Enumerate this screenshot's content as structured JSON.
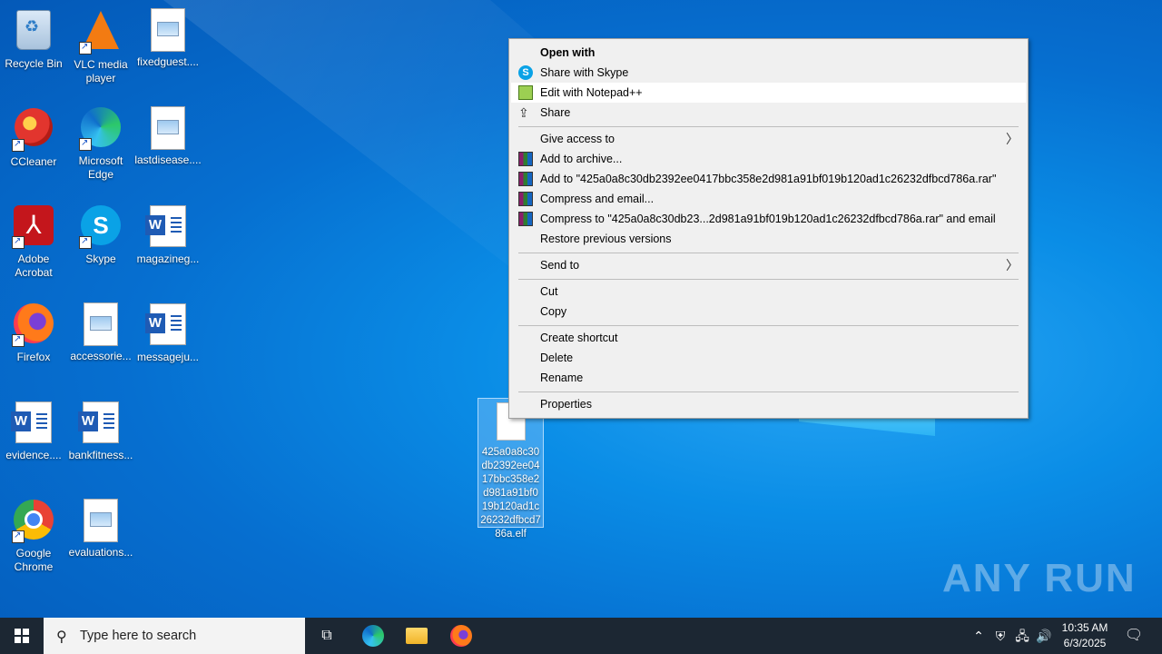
{
  "desktop": {
    "icons": [
      {
        "label": "Recycle Bin"
      },
      {
        "label": "VLC media player"
      },
      {
        "label": "fixedguest...."
      },
      {
        "label": "CCleaner"
      },
      {
        "label": "Microsoft Edge"
      },
      {
        "label": "lastdisease...."
      },
      {
        "label": "Adobe Acrobat"
      },
      {
        "label": "Skype"
      },
      {
        "label": "magazineg..."
      },
      {
        "label": "Firefox"
      },
      {
        "label": "accessorie..."
      },
      {
        "label": "messageju..."
      },
      {
        "label": "evidence...."
      },
      {
        "label": "bankfitness..."
      },
      {
        "label": "Google Chrome"
      },
      {
        "label": "evaluations..."
      }
    ],
    "selected_file": {
      "label": "425a0a8c30db2392ee0417bbc358e2d981a91bf019b120ad1c26232dfbcd786a.elf"
    },
    "watermark": "ANY RUN"
  },
  "context_menu": {
    "items": [
      {
        "label": "Open with",
        "icon": "none"
      },
      {
        "label": "Share with Skype",
        "icon": "skype-icon"
      },
      {
        "label": "Edit with Notepad++",
        "icon": "notepadpp-icon"
      },
      {
        "label": "Share",
        "icon": "share-icon"
      },
      {
        "label": "Give access to",
        "icon": "none"
      },
      {
        "label": "Add to archive...",
        "icon": "winrar-icon"
      },
      {
        "label": "Add to \"425a0a8c30db2392ee0417bbc358e2d981a91bf019b120ad1c26232dfbcd786a.rar\"",
        "icon": "winrar-icon"
      },
      {
        "label": "Compress and email...",
        "icon": "winrar-icon"
      },
      {
        "label": "Compress to \"425a0a8c30db23...2d981a91bf019b120ad1c26232dfbcd786a.rar\" and email",
        "icon": "winrar-icon"
      },
      {
        "label": "Restore previous versions",
        "icon": "none"
      },
      {
        "label": "Send to",
        "icon": "none"
      },
      {
        "label": "Cut",
        "icon": "none"
      },
      {
        "label": "Copy",
        "icon": "none"
      },
      {
        "label": "Create shortcut",
        "icon": "none"
      },
      {
        "label": "Delete",
        "icon": "none"
      },
      {
        "label": "Rename",
        "icon": "none"
      },
      {
        "label": "Properties",
        "icon": "none"
      }
    ]
  },
  "taskbar": {
    "search_placeholder": "Type here to search",
    "time": "10:35 AM",
    "date": "6/3/2025"
  }
}
